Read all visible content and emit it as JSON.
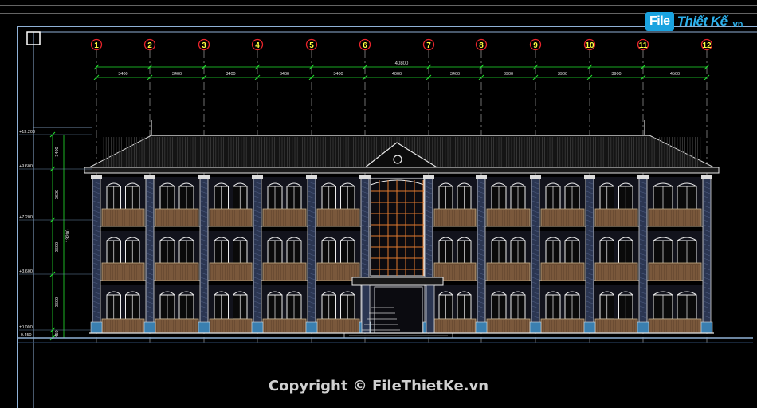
{
  "logo": {
    "file": "File",
    "thietke": "Thiết Kế",
    "vn": ".vn"
  },
  "grid_axes": [
    "1",
    "2",
    "3",
    "4",
    "5",
    "6",
    "7",
    "8",
    "9",
    "10",
    "11",
    "12"
  ],
  "dimensions": {
    "total": "40800",
    "spans": [
      "3400",
      "3400",
      "3400",
      "3400",
      "3400",
      "4000",
      "3400",
      "3900",
      "3900",
      "3900",
      "4500"
    ]
  },
  "levels": [
    "+13.200",
    "+9.600",
    "+7.200",
    "+3.600",
    "±0.000",
    "-0.450"
  ],
  "floor_heights": [
    "3400",
    "3600",
    "3600",
    "3600",
    "450"
  ],
  "overall_height": "13200",
  "copyright": "Copyright © FileThietKe.vn",
  "colors": {
    "axis_red": "#e8242b",
    "dimension_green": "#22e22e",
    "frame_blue": "#8fb1d6",
    "wall_purple": "#5a6e9c",
    "railing_brown": "#6b4c33",
    "facade_white": "#ececec",
    "window_orange": "#e07a2e"
  }
}
